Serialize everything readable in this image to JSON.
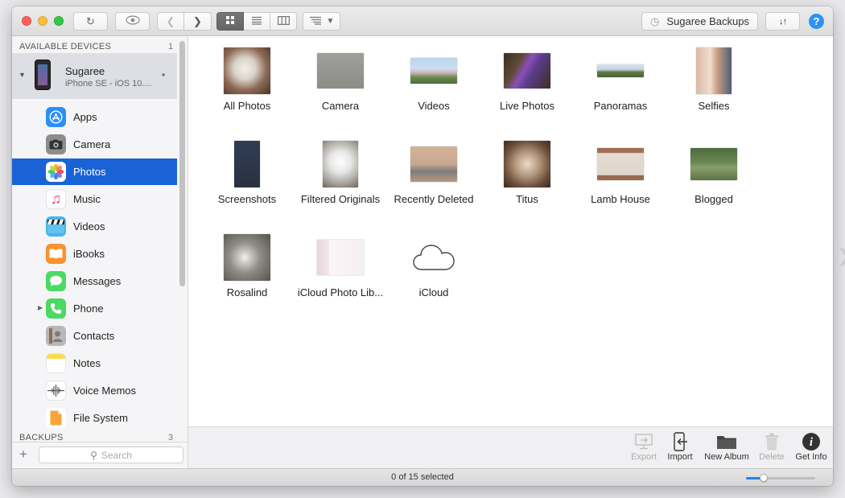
{
  "toolbar": {
    "refresh_icon": "refresh-icon",
    "preview_icon": "eye-icon",
    "back_icon": "chevron-left-icon",
    "forward_icon": "chevron-right-icon",
    "view_modes": [
      "grid-view-icon",
      "list-view-icon",
      "column-view-icon"
    ],
    "sort_icon": "sort-list-icon",
    "backup_button_label": "Sugaree Backups",
    "transfer_icon": "transfer-arrows-icon",
    "help_label": "?"
  },
  "sidebar": {
    "devices_header": "AVAILABLE DEVICES",
    "devices_count": "1",
    "device": {
      "name": "Sugaree",
      "subtitle": "iPhone SE - iOS 10...."
    },
    "items": [
      {
        "label": "Apps",
        "icon": "apps-icon",
        "color": "#2c8ef5"
      },
      {
        "label": "Camera",
        "icon": "camera-icon",
        "color": "#6b6b6b"
      },
      {
        "label": "Photos",
        "icon": "photos-icon",
        "color": "#ffffff",
        "selected": true
      },
      {
        "label": "Music",
        "icon": "music-icon",
        "color": "#ffffff"
      },
      {
        "label": "Videos",
        "icon": "videos-icon",
        "color": "#4ab3e6"
      },
      {
        "label": "iBooks",
        "icon": "ibooks-icon",
        "color": "#f7932c"
      },
      {
        "label": "Messages",
        "icon": "messages-icon",
        "color": "#4cd964"
      },
      {
        "label": "Phone",
        "icon": "phone-icon",
        "color": "#4cd964"
      },
      {
        "label": "Contacts",
        "icon": "contacts-icon",
        "color": "#a0a0a0"
      },
      {
        "label": "Notes",
        "icon": "notes-icon",
        "color": "#ffd84d"
      },
      {
        "label": "Voice Memos",
        "icon": "voice-memos-icon",
        "color": "#ffffff"
      },
      {
        "label": "File System",
        "icon": "file-system-icon",
        "color": "#ffffff"
      }
    ],
    "backups_header": "BACKUPS",
    "backups_count": "3",
    "search_placeholder": "Search"
  },
  "albums": [
    {
      "label": "All Photos"
    },
    {
      "label": "Camera"
    },
    {
      "label": "Videos"
    },
    {
      "label": "Live Photos"
    },
    {
      "label": "Panoramas"
    },
    {
      "label": "Selfies"
    },
    {
      "label": "Screenshots"
    },
    {
      "label": "Filtered Originals"
    },
    {
      "label": "Recently Deleted"
    },
    {
      "label": "Titus"
    },
    {
      "label": "Lamb House"
    },
    {
      "label": "Blogged"
    },
    {
      "label": "Rosalind"
    },
    {
      "label": "iCloud Photo Lib..."
    },
    {
      "label": "iCloud"
    }
  ],
  "actions": {
    "export": "Export",
    "import": "Import",
    "new_album": "New Album",
    "delete": "Delete",
    "get_info": "Get Info"
  },
  "status": {
    "selection": "0 of 15 selected",
    "zoom_fraction": 0.25
  }
}
